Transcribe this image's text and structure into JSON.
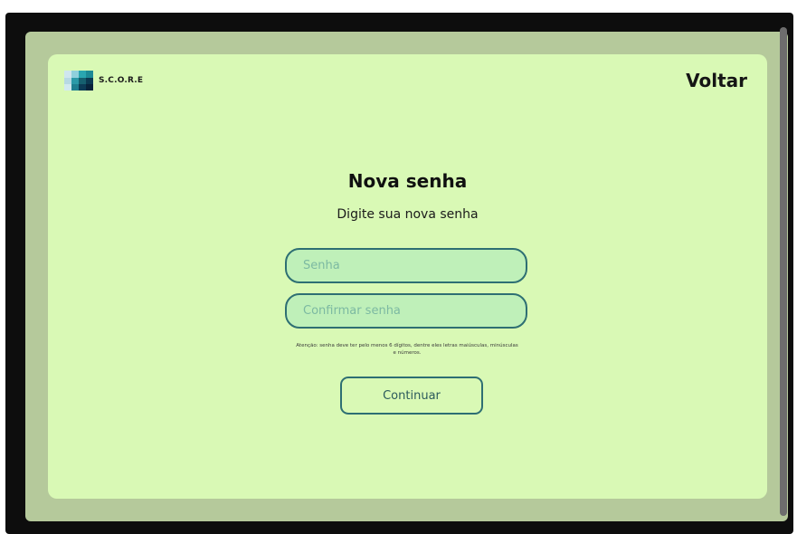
{
  "header": {
    "logo_text": "S.C.O.R.E",
    "back_link": "Voltar"
  },
  "main": {
    "title": "Nova senha",
    "subtitle": "Digite sua nova senha",
    "password_placeholder": "Senha",
    "confirm_placeholder": "Confirmar senha",
    "warning": "Atenção: senha deve ter pelo menos 6 dígitos, dentre eles letras maiúsculas, minúsculas e números.",
    "continue_label": "Continuar"
  },
  "colors": {
    "background": "#d9f9b5",
    "outer_panel": "#b5c99b",
    "field_fill": "#bff0b9",
    "accent_border": "#2e6f73"
  },
  "icons": {
    "logo": "score-logo-icon"
  }
}
